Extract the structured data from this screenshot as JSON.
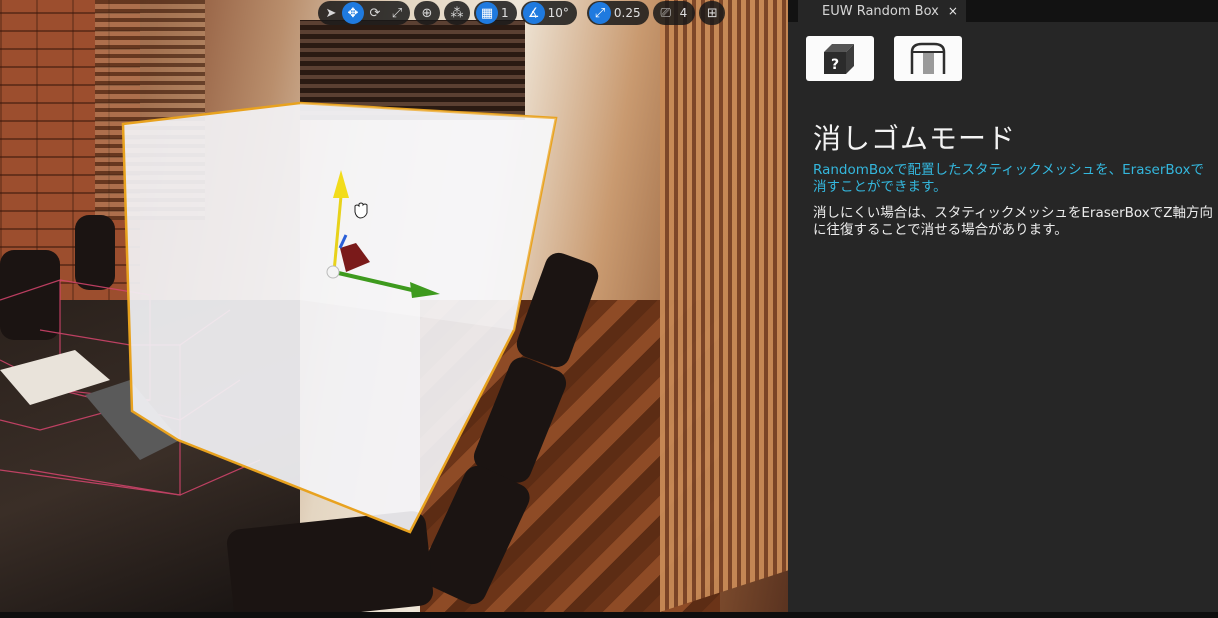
{
  "toolbar": {
    "select_icon": "cursor-select-icon",
    "translate_icon": "move-arrows-icon",
    "rotate_icon": "rotate-icon",
    "scale_icon": "scale-icon",
    "world_local_icon": "globe-icon",
    "surface_snap_icon": "surface-snap-icon",
    "grid_snap_value": "1",
    "rotation_snap_value": "10°",
    "scale_snap_value": "0.25",
    "camera_speed_value": "4"
  },
  "panel": {
    "tab_title": "EUW Random Box",
    "tab_close": "×",
    "random_box_icon_label": "?",
    "heading": "消しゴムモード",
    "description": "RandomBoxで配置したスタティックメッシュを、EraserBoxで消すことができます。",
    "note": "消しにくい場合は、スタティックメッシュをEraserBoxでZ軸方向に往復することで消せる場合があります。"
  },
  "colors": {
    "accent_blue": "#1f7adf",
    "description_text": "#34b7dd",
    "panel_bg": "#262626",
    "gizmo_x": "#3e9a1e",
    "gizmo_z": "#e8d21a",
    "box_outline": "#e8a21f"
  }
}
